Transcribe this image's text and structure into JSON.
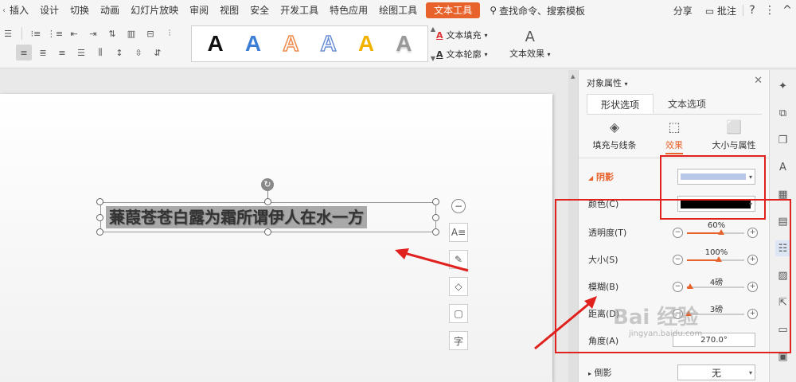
{
  "menu": {
    "items": [
      "插入",
      "设计",
      "切换",
      "动画",
      "幻灯片放映",
      "审阅",
      "视图",
      "安全",
      "开发工具",
      "特色应用",
      "绘图工具"
    ],
    "active_tab": "文本工具",
    "search": "查找命令、搜索模板",
    "share": "分享",
    "annotate": "批注",
    "help": "?",
    "more": "⋮",
    "collapse": "^"
  },
  "toolbar": {
    "text_styles": [
      {
        "letter": "A",
        "color": "#111111",
        "style": "solid"
      },
      {
        "letter": "A",
        "color": "#3d7fd6",
        "style": "solid"
      },
      {
        "letter": "A",
        "color": "#f08a4b",
        "style": "outline"
      },
      {
        "letter": "A",
        "color": "#6b8fd6",
        "style": "outline"
      },
      {
        "letter": "A",
        "color": "#f2b200",
        "style": "solid"
      },
      {
        "letter": "A",
        "color": "#999999",
        "style": "gradient"
      }
    ],
    "text_fill": "文本填充",
    "text_outline": "文本轮廓",
    "text_effect": "文本效果"
  },
  "slide": {
    "textbox_text": "蒹葭苍苍白露为霜所谓伊人在水一方"
  },
  "panel": {
    "title": "对象属性",
    "tabs": [
      "形状选项",
      "文本选项"
    ],
    "sub_tabs": [
      "填充与线条",
      "效果",
      "大小与属性"
    ],
    "active_sub_tab": 1,
    "shadow_section": "阴影",
    "color_label": "颜色(C)",
    "transparency_label": "透明度(T)",
    "transparency_value": "60%",
    "transparency_fraction": 0.6,
    "size_label": "大小(S)",
    "size_value": "100%",
    "size_fraction": 0.55,
    "blur_label": "模糊(B)",
    "blur_value": "4磅",
    "blur_fraction": 0.05,
    "distance_label": "距离(D)",
    "distance_value": "3磅",
    "distance_fraction": 0.03,
    "angle_label": "角度(A)",
    "angle_value": "270.0°",
    "reflection_section": "倒影",
    "reflection_value": "无",
    "shadow_color": "#b8c8e8",
    "color_value": "#000000"
  },
  "watermark": {
    "text": "Bai 经验",
    "url": "jingyan.baidu.com"
  },
  "colors": {
    "accent": "#e8622c",
    "annotation_red": "#e0211e"
  }
}
